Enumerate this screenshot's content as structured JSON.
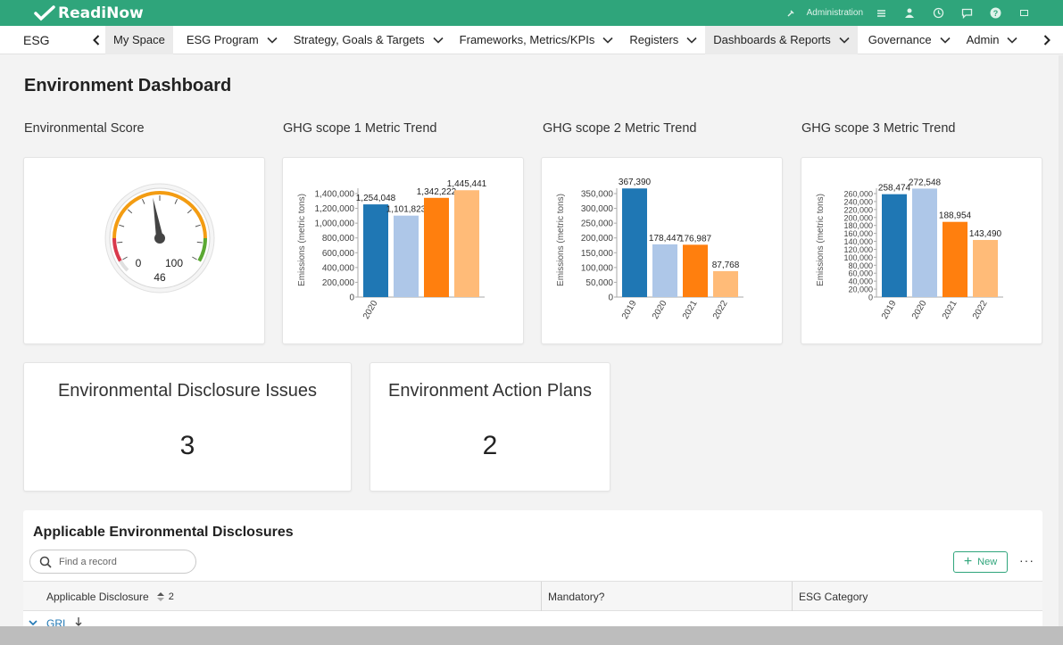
{
  "app": {
    "logo_text": "ReadiNow",
    "brand_color": "#2fa57b"
  },
  "topbar": {
    "admin_label": "Administration",
    "icons": [
      "wrench-icon",
      "menu-icon",
      "user-icon",
      "history-icon",
      "chat-icon",
      "help-icon",
      "expand-icon"
    ]
  },
  "nav": {
    "app_name": "ESG",
    "items": [
      {
        "label": "My Space",
        "active": true,
        "has_menu": false
      },
      {
        "label": "ESG Program",
        "has_menu": true
      },
      {
        "label": "Strategy, Goals & Targets",
        "has_menu": true
      },
      {
        "label": "Frameworks, Metrics/KPIs",
        "has_menu": true
      },
      {
        "label": "Registers",
        "has_menu": true
      },
      {
        "label": "Dashboards & Reports",
        "active": true,
        "has_menu": true
      },
      {
        "label": "Governance",
        "has_menu": true
      },
      {
        "label": "Admin",
        "has_menu": true
      }
    ]
  },
  "page": {
    "title": "Environment Dashboard"
  },
  "widgets": {
    "score_title": "Environmental Score",
    "scope1_title": "GHG scope 1 Metric Trend",
    "scope2_title": "GHG scope 2 Metric Trend",
    "scope3_title": "GHG scope 3 Metric Trend"
  },
  "gauge": {
    "min_label": "0",
    "max_label": "100",
    "value": 46,
    "value_label": "46"
  },
  "chart_data": [
    {
      "type": "bar",
      "title": "GHG scope 1 Metric Trend",
      "ylabel": "Emissions (metric tons)",
      "categories": [
        "2020",
        "",
        "",
        ""
      ],
      "values": [
        1254048,
        1101823,
        1342222,
        1445441
      ],
      "value_labels": [
        "1,254,048",
        "1,101,823",
        "1,342,222",
        "1,445,441"
      ],
      "colors": [
        "#1f77b4",
        "#aec7e8",
        "#ff7f0e",
        "#ffbb78"
      ],
      "yticks": [
        "0",
        "200,000",
        "400,000",
        "600,000",
        "800,000",
        "1,000,000",
        "1,200,000",
        "1,400,000"
      ],
      "ylim": [
        0,
        1400000
      ]
    },
    {
      "type": "bar",
      "title": "GHG scope 2 Metric Trend",
      "ylabel": "Emissions (metric tons)",
      "categories": [
        "2019",
        "2020",
        "2021",
        "2022"
      ],
      "values": [
        367390,
        178447,
        176987,
        87768
      ],
      "value_labels": [
        "367,390",
        "178,447",
        "176,987",
        "87,768"
      ],
      "colors": [
        "#1f77b4",
        "#aec7e8",
        "#ff7f0e",
        "#ffbb78"
      ],
      "yticks": [
        "0",
        "50,000",
        "100,000",
        "150,000",
        "200,000",
        "250,000",
        "300,000",
        "350,000"
      ],
      "ylim": [
        0,
        350000
      ]
    },
    {
      "type": "bar",
      "title": "GHG scope 3 Metric Trend",
      "ylabel": "Emissions (metric tons)",
      "categories": [
        "2019",
        "2020",
        "2021",
        "2022"
      ],
      "values": [
        258474,
        272548,
        188954,
        143490
      ],
      "value_labels": [
        "258,474",
        "272,548",
        "188,954",
        "143,490"
      ],
      "colors": [
        "#1f77b4",
        "#aec7e8",
        "#ff7f0e",
        "#ffbb78"
      ],
      "yticks": [
        "0",
        "20,000",
        "40,000",
        "60,000",
        "80,000",
        "100,000",
        "120,000",
        "140,000",
        "160,000",
        "180,000",
        "200,000",
        "220,000",
        "240,000",
        "260,000"
      ],
      "ylim": [
        0,
        260000
      ]
    }
  ],
  "kpis": [
    {
      "title": "Environmental Disclosure Issues",
      "value": "3"
    },
    {
      "title": "Environment Action Plans",
      "value": "2"
    }
  ],
  "table": {
    "title": "Applicable Environmental Disclosures",
    "search_placeholder": "Find a record",
    "new_label": "New",
    "more_label": "···",
    "columns": [
      {
        "label": "Applicable Disclosure",
        "sort_count": "2"
      },
      {
        "label": "Mandatory?"
      },
      {
        "label": "ESG Category"
      }
    ],
    "group_label": "GRI"
  }
}
